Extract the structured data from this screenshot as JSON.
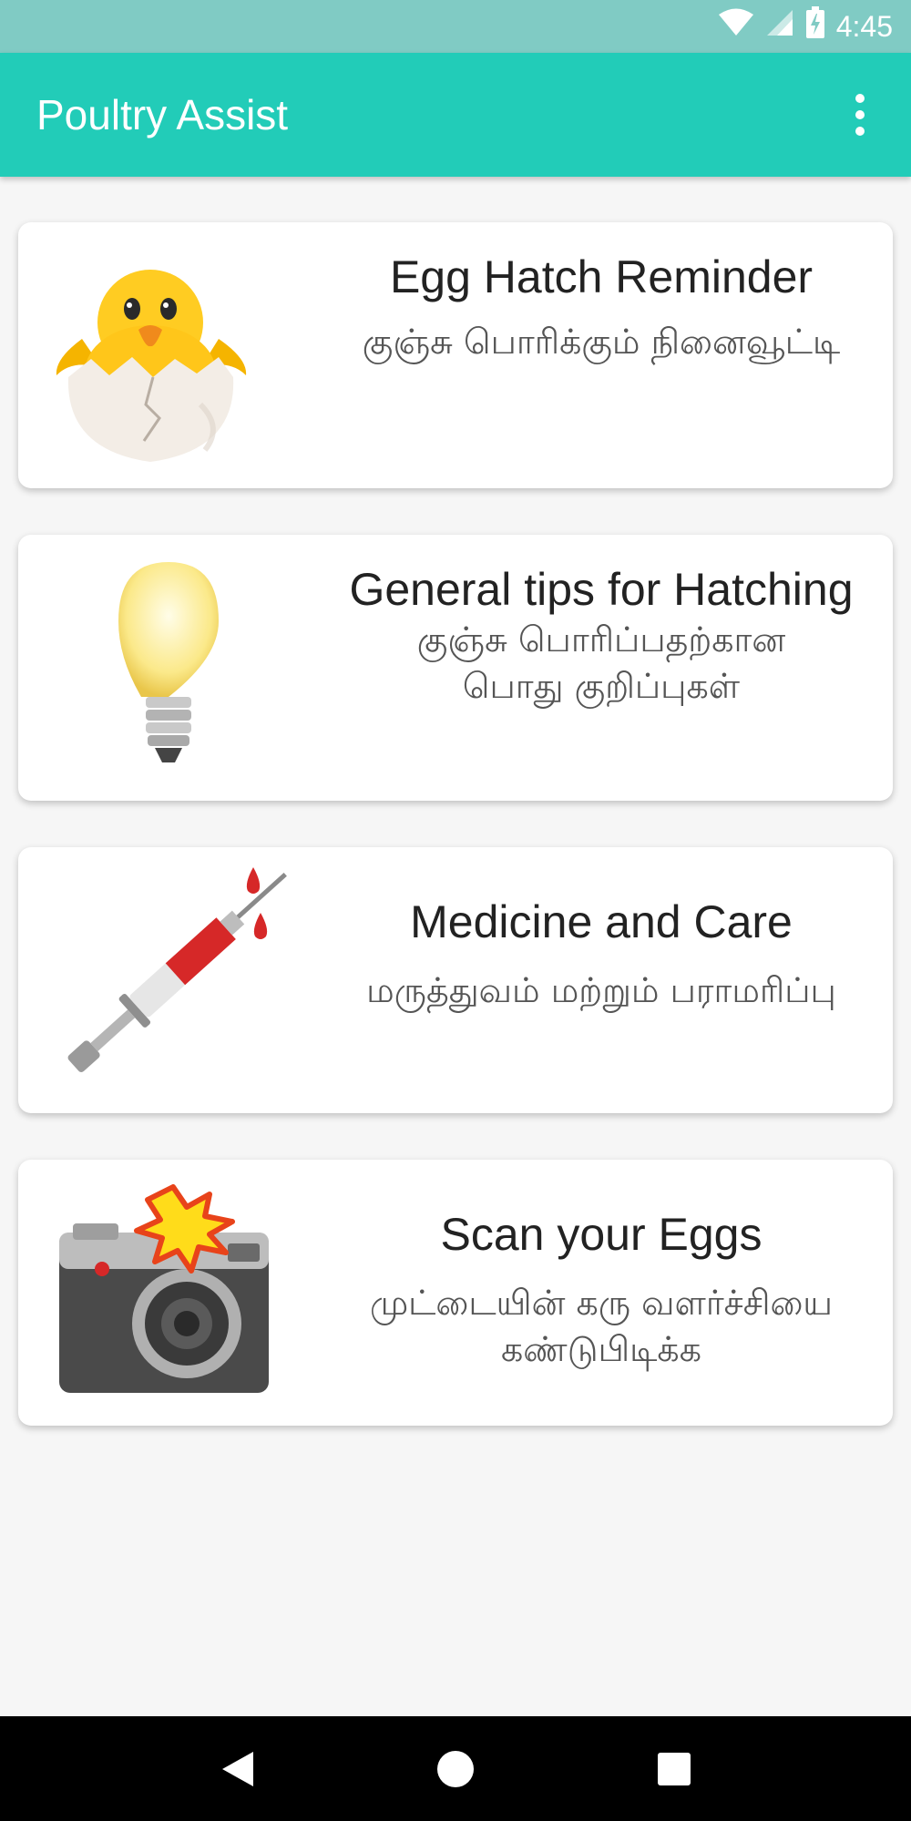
{
  "status_bar": {
    "time": "4:45",
    "icons": [
      "wifi-icon",
      "cellular-signal-icon",
      "battery-charging-icon"
    ]
  },
  "app_bar": {
    "title": "Poultry Assist",
    "menu_icon": "overflow-menu-icon"
  },
  "cards": [
    {
      "title": "Egg Hatch Reminder",
      "subtitle_line1": "குஞ்சு பொரிக்கும் நினைவூட்டி",
      "subtitle_line2": "",
      "icon": "hatching-chick-icon"
    },
    {
      "title": "General tips  for Hatching",
      "subtitle_line1": "குஞ்சு பொரிப்பதற்கான",
      "subtitle_line2": "பொது குறிப்புகள்",
      "icon": "light-bulb-icon"
    },
    {
      "title": "Medicine and Care",
      "subtitle_line1": "மருத்துவம் மற்றும் பராமரிப்பு",
      "subtitle_line2": "",
      "icon": "syringe-icon"
    },
    {
      "title": "Scan your Eggs",
      "subtitle_line1": "முட்டையின் கரு வளர்ச்சியை",
      "subtitle_line2": "கண்டுபிடிக்க",
      "icon": "camera-flash-icon"
    }
  ],
  "nav_bar": {
    "icons": [
      "back-icon",
      "home-icon",
      "recents-icon"
    ]
  },
  "colors": {
    "status_bar": "#80cbc4",
    "app_bar": "#22ccb8",
    "background": "#f6f6f6",
    "nav_bar": "#000000"
  }
}
